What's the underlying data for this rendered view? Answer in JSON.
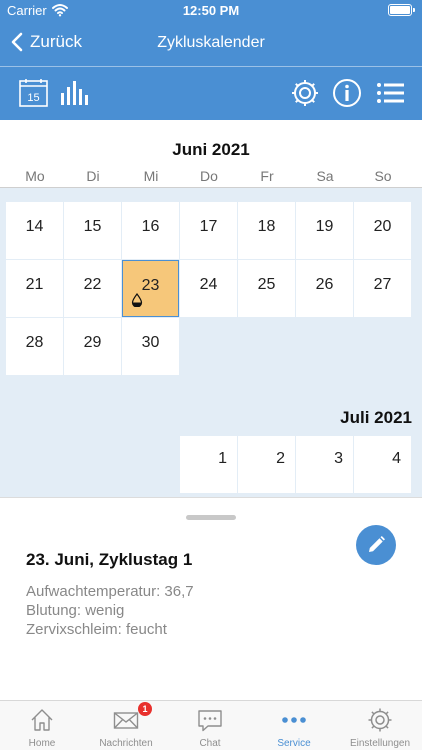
{
  "status_bar": {
    "carrier": "Carrier",
    "time": "12:50 PM"
  },
  "nav": {
    "back_label": "Zurück",
    "title": "Zykluskalender"
  },
  "toolbar": {
    "left_icons": [
      "calendar-icon",
      "bar-chart-icon"
    ],
    "calendar_icon_day": "15",
    "right_icons": [
      "gear-icon",
      "info-icon",
      "list-icon"
    ]
  },
  "calendar": {
    "month1": {
      "title": "Juni 2021",
      "weekdays": [
        "Mo",
        "Di",
        "Mi",
        "Do",
        "Fr",
        "Sa",
        "So"
      ],
      "rows": [
        [
          "14",
          "15",
          "16",
          "17",
          "18",
          "19",
          "20"
        ],
        [
          "21",
          "22",
          "23",
          "24",
          "25",
          "26",
          "27"
        ],
        [
          "28",
          "29",
          "30"
        ]
      ],
      "selected_day": "23"
    },
    "month2": {
      "title": "Juli 2021",
      "rows": [
        [
          "1",
          "2",
          "3",
          "4"
        ]
      ]
    }
  },
  "detail": {
    "title": "23. Juni, Zyklustag 1",
    "lines": [
      "Aufwachtemperatur: 36,7",
      "Blutung: wenig",
      "Zervixschleim: feucht"
    ]
  },
  "tabbar": {
    "tabs": [
      {
        "label": "Home",
        "icon": "house-icon"
      },
      {
        "label": "Nachrichten",
        "icon": "envelope-icon",
        "badge": "1"
      },
      {
        "label": "Chat",
        "icon": "chat-bubble-icon"
      },
      {
        "label": "Service",
        "icon": "more-dots-icon",
        "active": true
      },
      {
        "label": "Einstellungen",
        "icon": "gear-icon"
      }
    ]
  },
  "colors": {
    "accent": "#4a8fd3",
    "selected_day": "#f6c77a",
    "badge": "#e8302c",
    "calendar_background": "#e3edf6"
  }
}
